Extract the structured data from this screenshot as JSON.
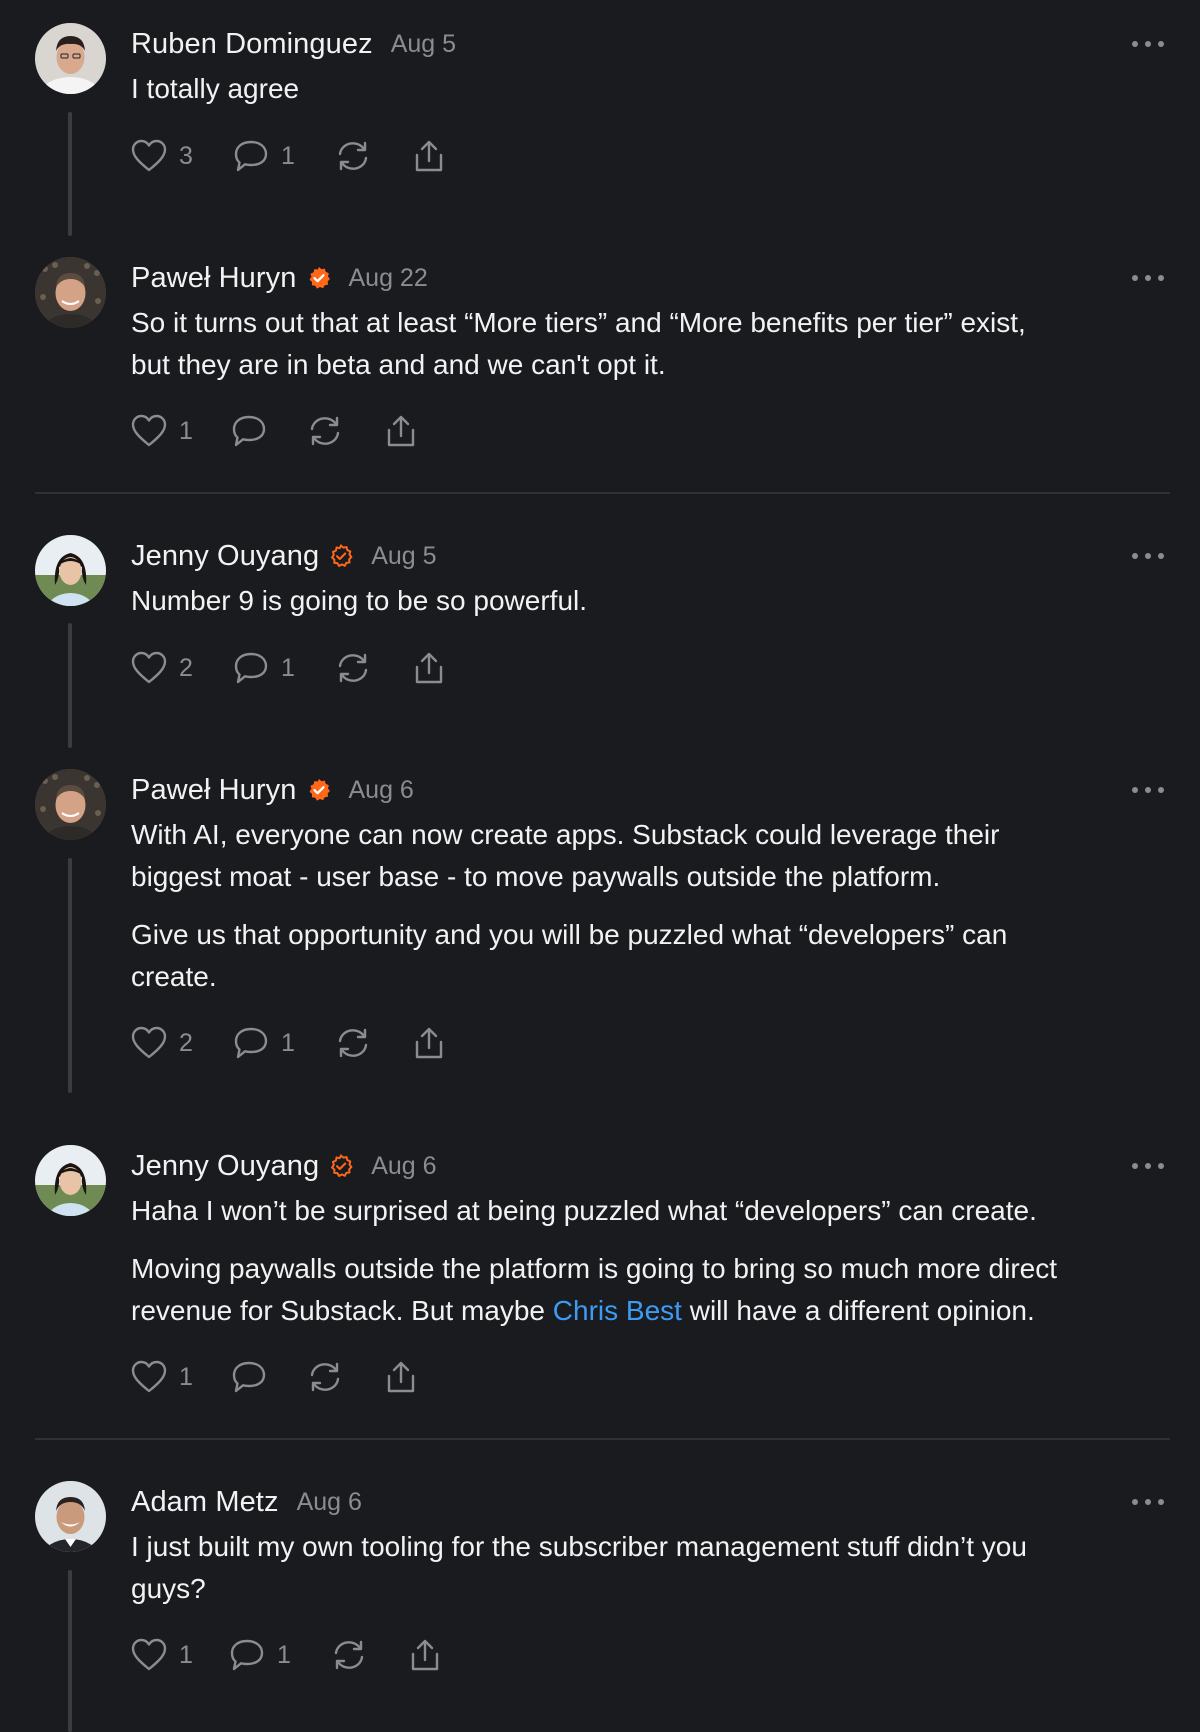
{
  "comments": [
    {
      "author": "Ruben Dominguez",
      "date": "Aug 5",
      "verified": "none",
      "avatar": "avatar-ruben",
      "paragraphs": [
        [
          "I totally agree"
        ]
      ],
      "likes": "3",
      "replies": "1"
    },
    {
      "author": "Paweł Huryn",
      "date": "Aug 22",
      "verified": "filled",
      "avatar": "avatar-pawel",
      "paragraphs": [
        [
          "So it turns out that at least “More tiers” and “More benefits per tier” exist,",
          "but they are in beta and and we can't opt it."
        ]
      ],
      "likes": "1",
      "replies": ""
    },
    {
      "author": "Jenny Ouyang",
      "date": "Aug 5",
      "verified": "outline",
      "avatar": "avatar-jenny",
      "paragraphs": [
        [
          "Number 9 is going to be so powerful."
        ]
      ],
      "likes": "2",
      "replies": "1"
    },
    {
      "author": "Paweł Huryn",
      "date": "Aug 6",
      "verified": "filled",
      "avatar": "avatar-pawel",
      "paragraphs": [
        [
          "With AI, everyone can now create apps. Substack could leverage their",
          "biggest moat - user base - to move paywalls outside the platform."
        ],
        [
          "Give us that opportunity and you will be puzzled what “developers” can",
          "create."
        ]
      ],
      "likes": "2",
      "replies": "1"
    },
    {
      "author": "Jenny Ouyang",
      "date": "Aug 6",
      "verified": "outline",
      "avatar": "avatar-jenny",
      "paragraphs": [
        [
          "Haha I won’t be surprised at being puzzled what “developers” can create."
        ],
        [
          "Moving paywalls outside the platform is going to bring so much more direct",
          "revenue for Substack. But maybe "
        ]
      ],
      "mention": "Chris Best",
      "mention_tail": " will have a different opinion.",
      "likes": "1",
      "replies": ""
    },
    {
      "author": "Adam Metz",
      "date": "Aug 6",
      "verified": "none",
      "avatar": "avatar-adam",
      "paragraphs": [
        [
          "I just built my own tooling for the subscriber management stuff didn’t you",
          "guys?"
        ]
      ],
      "likes": "1",
      "replies": "1"
    }
  ],
  "colors": {
    "background": "#1a1b1e",
    "text": "#f2f2f2",
    "muted": "#8b8c91",
    "verified": "#ff6719",
    "link": "#3c9cf5"
  }
}
